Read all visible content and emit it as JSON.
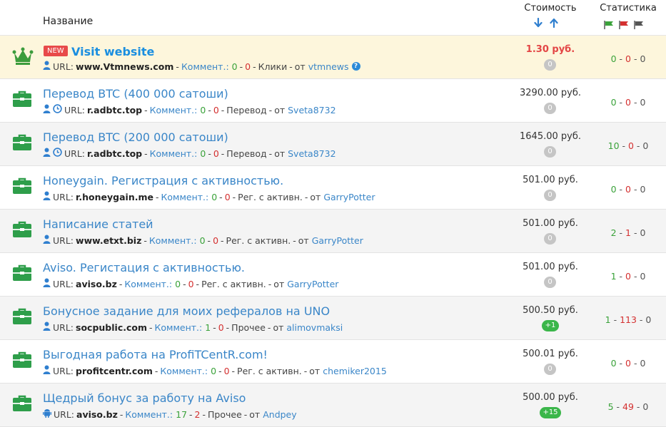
{
  "header": {
    "name_col": "Название",
    "cost_col": "Стоимость",
    "stats_col": "Статистика",
    "sort_desc_icon": "arrow-down-icon",
    "sort_asc_icon": "arrow-up-icon"
  },
  "colors": {
    "accent": "#3a86c8",
    "green": "#3aa23a",
    "red": "#d43030",
    "briefcase": "#2e9e4a",
    "crown": "#3c9c3c"
  },
  "labels": {
    "url": "URL:",
    "comment": "Коммент.:",
    "from": "от"
  },
  "rows": [
    {
      "icon": "crown-icon",
      "badge": "NEW",
      "title": "Visit website",
      "url": "www.Vtmnews.com",
      "comments_good": "0",
      "comments_bad": "0",
      "type": "Клики",
      "author": "vtmnews",
      "price": "1.30 руб.",
      "counter": "0",
      "stat_done": "0",
      "stat_fail": "0",
      "stat_other": "0"
    },
    {
      "icon": "briefcase-icon",
      "title": "Перевод BTC (400 000 сатоши)",
      "url": "r.adbtc.top",
      "comments_good": "0",
      "comments_bad": "0",
      "type": "Перевод",
      "author": "Sveta8732",
      "price": "3290.00 руб.",
      "counter": "0",
      "stat_done": "0",
      "stat_fail": "0",
      "stat_other": "0"
    },
    {
      "icon": "briefcase-icon",
      "title": "Перевод BTC (200 000 сатоши)",
      "url": "r.adbtc.top",
      "comments_good": "0",
      "comments_bad": "0",
      "type": "Перевод",
      "author": "Sveta8732",
      "price": "1645.00 руб.",
      "counter": "0",
      "stat_done": "10",
      "stat_fail": "0",
      "stat_other": "0"
    },
    {
      "icon": "briefcase-icon",
      "title": "Honeygain. Регистрация с активностью.",
      "url": "r.honeygain.me",
      "comments_good": "0",
      "comments_bad": "0",
      "type": "Рег. с активн.",
      "author": "GarryPotter",
      "price": "501.00 руб.",
      "counter": "0",
      "stat_done": "0",
      "stat_fail": "0",
      "stat_other": "0"
    },
    {
      "icon": "briefcase-icon",
      "title": "Написание статей",
      "url": "www.etxt.biz",
      "comments_good": "0",
      "comments_bad": "0",
      "type": "Рег. с активн.",
      "author": "GarryPotter",
      "price": "501.00 руб.",
      "counter": "0",
      "stat_done": "2",
      "stat_fail": "1",
      "stat_other": "0"
    },
    {
      "icon": "briefcase-icon",
      "title": "Aviso. Регистация с активностью.",
      "url": "aviso.bz",
      "comments_good": "0",
      "comments_bad": "0",
      "type": "Рег. с активн.",
      "author": "GarryPotter",
      "price": "501.00 руб.",
      "counter": "0",
      "stat_done": "1",
      "stat_fail": "0",
      "stat_other": "0"
    },
    {
      "icon": "briefcase-icon",
      "title": "Бонусное задание для моих рефералов на UNO",
      "url": "socpublic.com",
      "comments_good": "1",
      "comments_bad": "0",
      "type": "Прочее",
      "author": "alimovmaksi",
      "price": "500.50 руб.",
      "counter": "+1",
      "stat_done": "1",
      "stat_fail": "113",
      "stat_other": "0"
    },
    {
      "icon": "briefcase-icon",
      "title": "Выгодная работа на ProfiTCentR.com!",
      "url": "profitcentr.com",
      "comments_good": "0",
      "comments_bad": "0",
      "type": "Рег. с активн.",
      "author": "chemiker2015",
      "price": "500.01 руб.",
      "counter": "0",
      "stat_done": "0",
      "stat_fail": "0",
      "stat_other": "0"
    },
    {
      "icon": "briefcase-icon",
      "title": "Щедрый бонус за работу на Aviso",
      "url": "aviso.bz",
      "comments_good": "17",
      "comments_bad": "2",
      "type": "Прочее",
      "author": "Andpey",
      "price": "500.00 руб.",
      "counter": "+15",
      "stat_done": "5",
      "stat_fail": "49",
      "stat_other": "0"
    }
  ]
}
